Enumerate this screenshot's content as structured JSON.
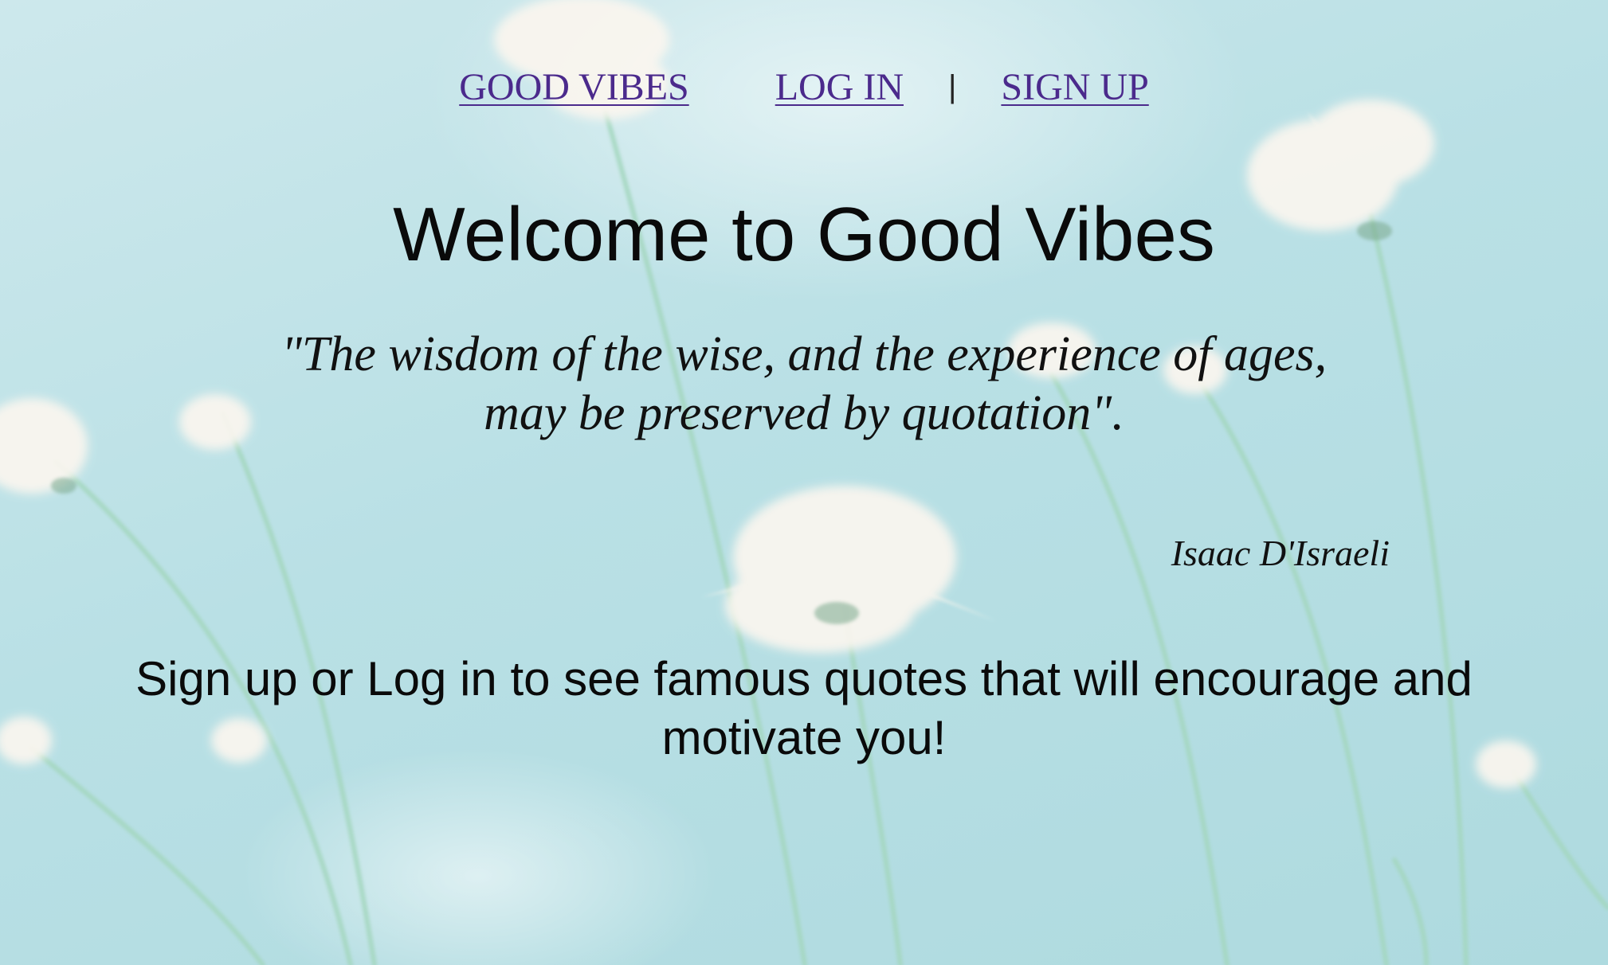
{
  "nav": {
    "brand": "GOOD VIBES",
    "login": "LOG IN",
    "separator": "|",
    "signup": "SIGN UP"
  },
  "title": "Welcome to Good Vibes",
  "quote": {
    "line1": "\"The wisdom of the wise, and the experience of ages,",
    "line2": "may be preserved by quotation\".",
    "author": "Isaac D'Israeli"
  },
  "cta": "Sign up or Log in to see famous quotes that will encourage and motivate you!",
  "colors": {
    "background": "#b9e0e5",
    "link": "#4b2a8c",
    "text": "#0a0a0a",
    "flower": "#fbf6ef",
    "stem": "#9fd3b8"
  },
  "background_image": "white-daisy-flowers-on-pale-teal"
}
